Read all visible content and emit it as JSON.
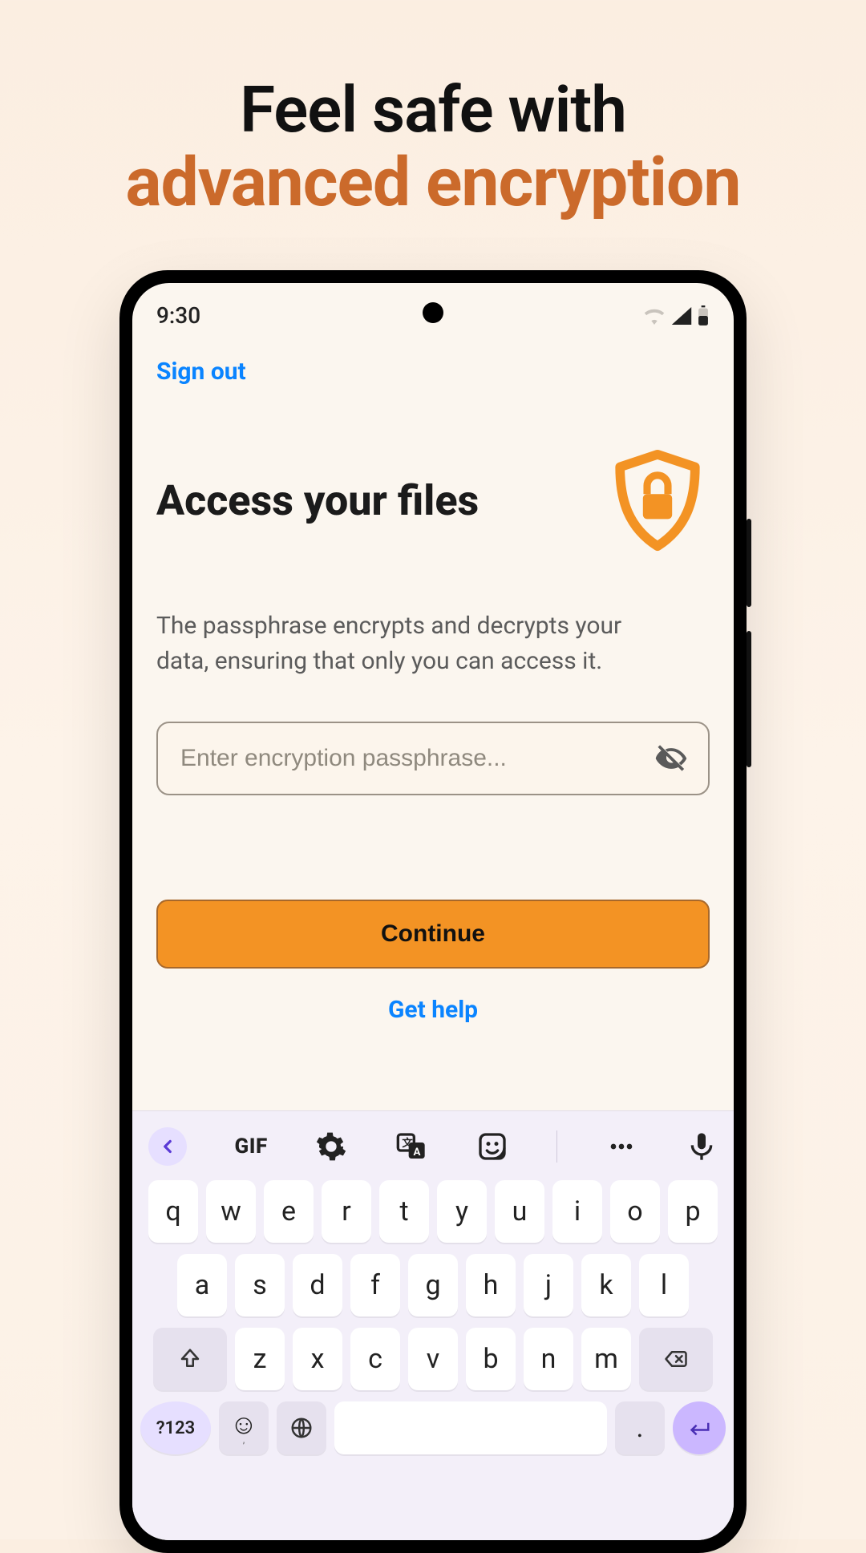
{
  "headline": {
    "line1": "Feel safe with",
    "line2": "advanced encryption"
  },
  "statusbar": {
    "time": "9:30"
  },
  "app": {
    "signout_label": "Sign out",
    "title": "Access your files",
    "description": "The passphrase encrypts and decrypts your data, ensuring that only you can access it.",
    "passphrase_placeholder": "Enter encryption passphrase...",
    "continue_label": "Continue",
    "help_label": "Get help"
  },
  "colors": {
    "accent": "#f39324",
    "accent_border": "#a7682b",
    "link": "#0a84ff",
    "headline_accent": "#cb6a2b"
  },
  "keyboard": {
    "toolbar": {
      "gif_label": "GIF"
    },
    "row1": [
      "q",
      "w",
      "e",
      "r",
      "t",
      "y",
      "u",
      "i",
      "o",
      "p"
    ],
    "row2": [
      "a",
      "s",
      "d",
      "f",
      "g",
      "h",
      "j",
      "k",
      "l"
    ],
    "row3": [
      "z",
      "x",
      "c",
      "v",
      "b",
      "n",
      "m"
    ],
    "symnum_label": "?123",
    "comma": ",",
    "period": "."
  }
}
